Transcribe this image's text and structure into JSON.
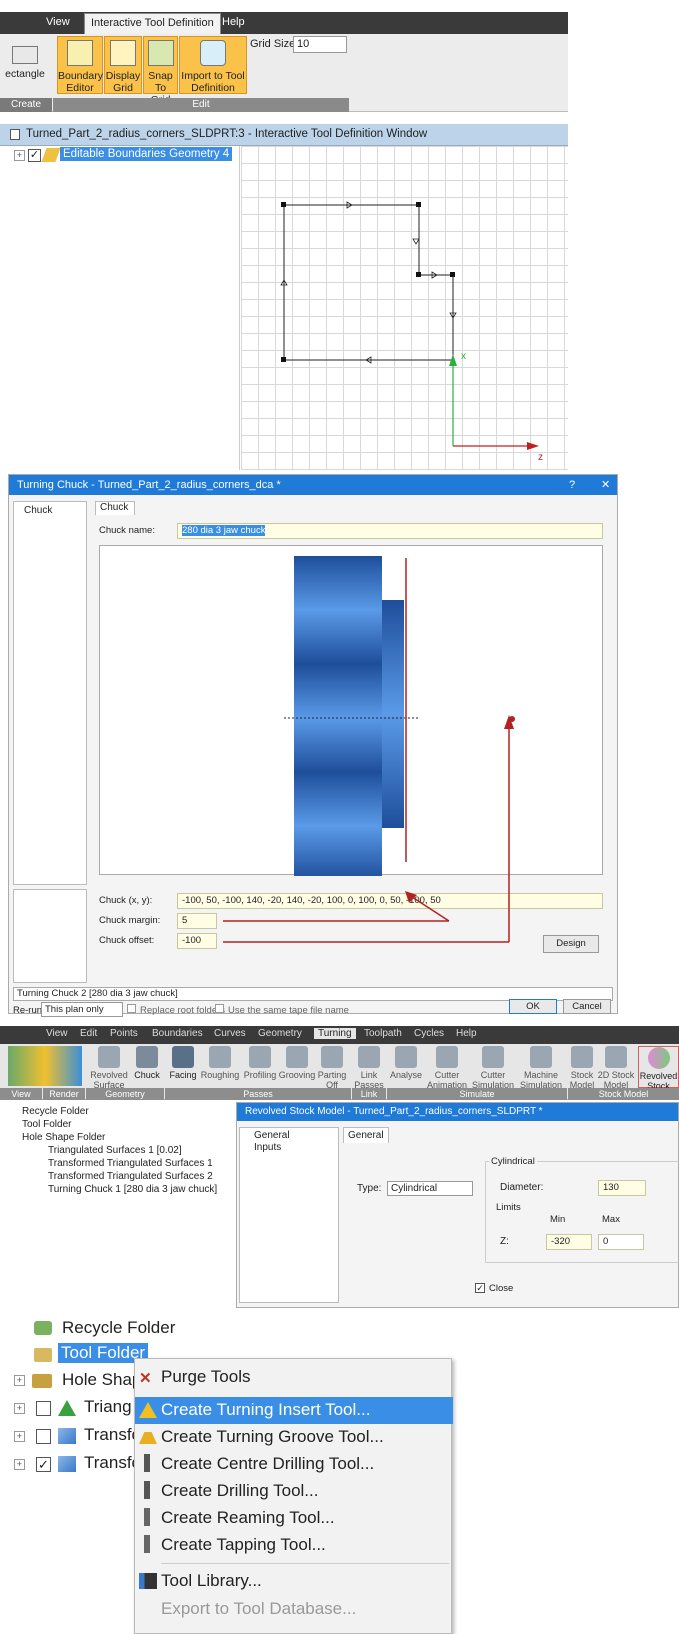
{
  "panel1": {
    "menu": {
      "view": "View",
      "itd": "Interactive Tool Definition",
      "help": "Help"
    },
    "ribbon": {
      "rectangle": "ectangle",
      "boundary_editor": [
        "Boundary",
        "Editor"
      ],
      "display_grid": [
        "Display",
        "Grid"
      ],
      "snap_to_grid": [
        "Snap",
        "To Grid"
      ],
      "import_tool": [
        "Import to Tool",
        "Definition"
      ],
      "grid_size_label": "Grid Size:",
      "grid_size_value": "10",
      "group_create": "Create",
      "group_edit": "Edit"
    },
    "window_title": "Turned_Part_2_radius_corners_SLDPRT:3 - Interactive Tool Definition Window",
    "tree_item": "Editable Boundaries Geometry 4",
    "axis_x": "x",
    "axis_z": "z"
  },
  "panel2": {
    "title": "Turning Chuck - Turned_Part_2_radius_corners_dca *",
    "help": "?",
    "close": "✕",
    "left_tab": "Chuck",
    "tab": "Chuck",
    "chuck_name_label": "Chuck name:",
    "chuck_name_value": "280 dia 3 jaw chuck",
    "chuck_xy_label": "Chuck (x, y):",
    "chuck_xy_value": "-100, 50, -100, 140, -20, 140, -20, 100, 0, 100, 0, 50, -100, 50",
    "margin_label": "Chuck margin:",
    "margin_value": "5",
    "offset_label": "Chuck offset:",
    "offset_value": "-100",
    "design_button": "Design",
    "status": "Turning Chuck 2 [280 dia 3 jaw chuck]",
    "rerun_label": "Re-run:",
    "rerun_value": "This plan only",
    "replace_root": "Replace root folders",
    "same_tape": "Use the same tape file name",
    "ok": "OK",
    "cancel": "Cancel"
  },
  "panel3": {
    "menu": [
      "View",
      "Edit",
      "Points",
      "Boundaries",
      "Curves",
      "Geometry",
      "Turning",
      "Toolpath",
      "Cycles",
      "Help"
    ],
    "ribbon": {
      "revolved_surface": [
        "Revolved",
        "Surface"
      ],
      "chuck": "Chuck",
      "facing": "Facing",
      "roughing": "Roughing",
      "profiling": "Profiling",
      "grooving": "Grooving",
      "parting_off": [
        "Parting",
        "Off"
      ],
      "link_passes": [
        "Link",
        "Passes"
      ],
      "analyse": "Analyse",
      "cutter_animation": [
        "Cutter",
        "Animation"
      ],
      "cutter_simulation": [
        "Cutter",
        "Simulation"
      ],
      "machine_simulation": [
        "Machine",
        "Simulation"
      ],
      "stock_model": [
        "Stock",
        "Model"
      ],
      "stock_2d": [
        "2D Stock",
        "Model"
      ],
      "revolved_stock": [
        "Revolved",
        "Stock"
      ],
      "groups": [
        "View",
        "Render",
        "Geometry",
        "Passes",
        "Link",
        "Simulate",
        "Stock Model"
      ]
    },
    "tree": [
      "Recycle Folder",
      "Tool Folder",
      "Hole Shape Folder",
      "Triangulated Surfaces 1 [0.02]",
      "Transformed Triangulated Surfaces 1",
      "Transformed Triangulated Surfaces 2",
      "Turning Chuck 1 [280 dia 3 jaw chuck]"
    ],
    "dialog": {
      "title": "Revolved Stock Model - Turned_Part_2_radius_corners_SLDPRT *",
      "nav_general": "General",
      "nav_inputs": "Inputs",
      "tab": "General",
      "type_label": "Type:",
      "type_value": "Cylindrical",
      "cyl_group": "Cylindrical",
      "diameter_label": "Diameter:",
      "diameter_value": "130",
      "limits_label": "Limits",
      "min_label": "Min",
      "max_label": "Max",
      "z_label": "Z:",
      "z_min": "-320",
      "z_max": "0",
      "close_label": "Close"
    }
  },
  "panel4": {
    "tree": [
      "Recycle Folder",
      "Tool Folder",
      "Hole Shap",
      "Triang",
      "Transfo",
      "Transfo"
    ],
    "menu": [
      "Purge Tools",
      "Create Turning Insert Tool...",
      "Create Turning Groove Tool...",
      "Create Centre Drilling Tool...",
      "Create Drilling Tool...",
      "Create Reaming Tool...",
      "Create Tapping Tool...",
      "Tool Library...",
      "Export to Tool Database..."
    ]
  },
  "colors": {
    "accent": "#1f7ad8",
    "highlight": "#3a8ee6",
    "ribbon_active": "#fbc24a",
    "chuck_blue": "#2e5fa8",
    "arrow_red": "#b22222"
  }
}
